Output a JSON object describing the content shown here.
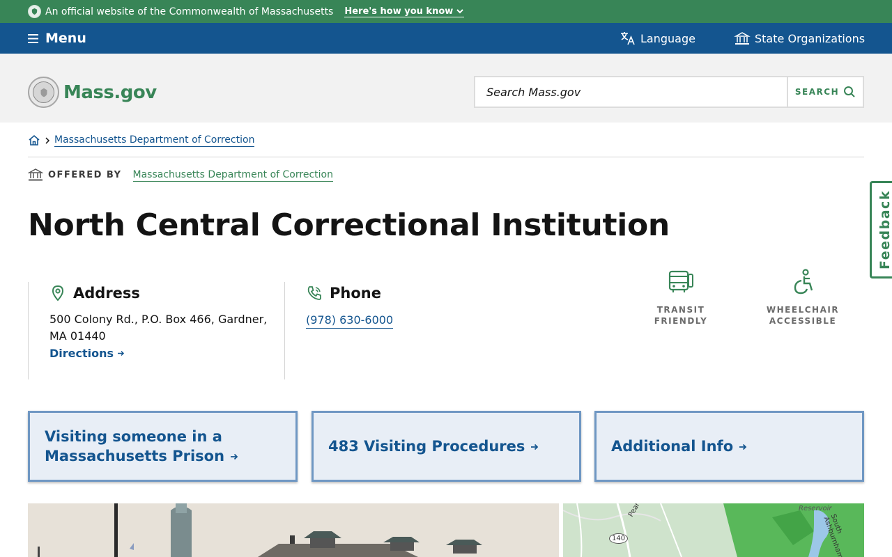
{
  "official_banner": {
    "text": "An official website of the Commonwealth of Massachusetts",
    "toggle_label": "Here's how you know"
  },
  "utility_nav": {
    "menu_label": "Menu",
    "language_label": "Language",
    "orgs_label": "State Organizations"
  },
  "header": {
    "logo_text": "Mass.gov",
    "search_placeholder": "Search Mass.gov",
    "search_button_label": "SEARCH"
  },
  "breadcrumb": {
    "items": [
      "Massachusetts Department of Correction"
    ]
  },
  "offered_by": {
    "label": "OFFERED BY",
    "org": "Massachusetts Department of Correction"
  },
  "page_title": "North Central Correctional Institution",
  "contact": {
    "address": {
      "heading": "Address",
      "text": "500 Colony Rd., P.O. Box 466, Gardner, MA 01440",
      "directions_label": "Directions"
    },
    "phone": {
      "heading": "Phone",
      "number": "(978) 630-6000"
    }
  },
  "features": [
    {
      "label": "TRANSIT FRIENDLY",
      "icon": "bus-icon"
    },
    {
      "label": "WHEELCHAIR ACCESSIBLE",
      "icon": "wheelchair-icon"
    }
  ],
  "feedback_label": "Feedback",
  "cards": [
    {
      "label": "Visiting someone in a Massachusetts Prison"
    },
    {
      "label": "483 Visiting Procedures"
    },
    {
      "label": "Additional Info"
    }
  ],
  "map": {
    "labels": [
      "Pearl Street",
      "Reservoir",
      "South Ashburnham"
    ],
    "route": "140"
  },
  "colors": {
    "green": "#388557",
    "blue": "#14558f",
    "card_bg": "#e8eef6",
    "card_border": "#6f97c3"
  }
}
